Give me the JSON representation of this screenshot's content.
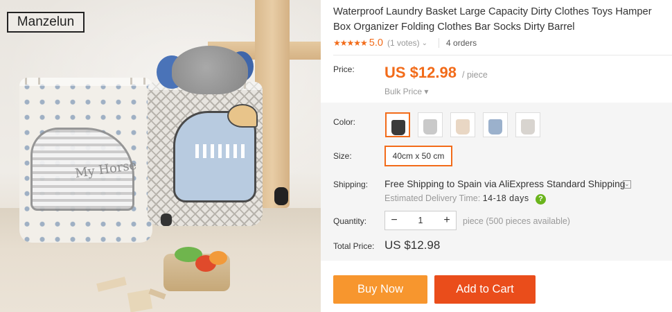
{
  "photo": {
    "brand_logo_text": "Manzelun",
    "basket_print_text": "My Horse"
  },
  "product": {
    "title": "Waterproof Laundry Basket Large Capacity Dirty Clothes Toys Hamper Box Organizer Folding Clothes Bar Socks Dirty Barrel",
    "rating": {
      "stars": "★★★★★",
      "score": "5.0",
      "votes": "(1 votes)",
      "orders": "4 orders"
    }
  },
  "price": {
    "label": "Price:",
    "value": "US $12.98",
    "unit": "/ piece",
    "bulk_label": "Bulk Price ▾"
  },
  "options": {
    "color_label": "Color:",
    "color_swatches": [
      {
        "name": "style-1",
        "color": "#3a3a3a",
        "selected": true
      },
      {
        "name": "style-2",
        "color": "#c9c9c9",
        "selected": false
      },
      {
        "name": "style-3",
        "color": "#e9d7c4",
        "selected": false
      },
      {
        "name": "style-4",
        "color": "#9bb1cc",
        "selected": false
      },
      {
        "name": "style-5",
        "color": "#d8d4cf",
        "selected": false
      }
    ],
    "size_label": "Size:",
    "size_value": "40cm x 50 cm"
  },
  "shipping": {
    "label": "Shipping:",
    "text": "Free Shipping to Spain via AliExpress Standard Shipping",
    "estimated_label": "Estimated Delivery Time:",
    "estimated_days": "14-18 days",
    "help_glyph": "?"
  },
  "quantity": {
    "label": "Quantity:",
    "minus": "−",
    "value": "1",
    "plus": "+",
    "note": "piece (500 pieces available)"
  },
  "total": {
    "label": "Total Price:",
    "value": "US $12.98"
  },
  "actions": {
    "buy_now": "Buy Now",
    "add_to_cart": "Add to Cart"
  },
  "colors": {
    "accent": "#f26b19",
    "buy_now_bg": "#f7962e",
    "add_to_cart_bg": "#ea4d1b",
    "help_icon": "#6ab41c"
  }
}
